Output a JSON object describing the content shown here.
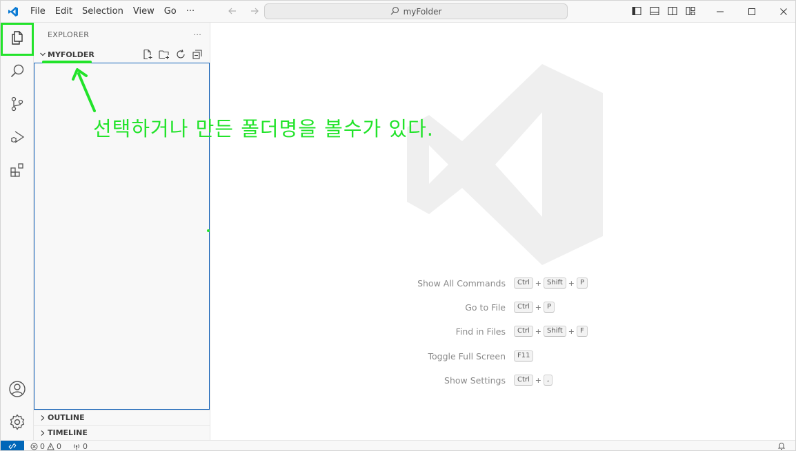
{
  "titlebar": {
    "menu": [
      "File",
      "Edit",
      "Selection",
      "View",
      "Go",
      "···"
    ],
    "search_text": "myFolder"
  },
  "sidebar": {
    "title": "EXPLORER",
    "more": "···",
    "folder_name": "MYFOLDER",
    "outline": "OUTLINE",
    "timeline": "TIMELINE"
  },
  "editor": {
    "shortcuts": [
      {
        "label": "Show All Commands",
        "keys": [
          "Ctrl",
          "Shift",
          "P"
        ]
      },
      {
        "label": "Go to File",
        "keys": [
          "Ctrl",
          "P"
        ]
      },
      {
        "label": "Find in Files",
        "keys": [
          "Ctrl",
          "Shift",
          "F"
        ]
      },
      {
        "label": "Toggle Full Screen",
        "keys": [
          "F11"
        ]
      },
      {
        "label": "Show Settings",
        "keys": [
          "Ctrl",
          ","
        ]
      }
    ]
  },
  "statusbar": {
    "errors": "0",
    "warnings": "0",
    "ports": "0"
  },
  "annotation": {
    "text": "선택하거나 만든 폴더명을 볼수가 있다.",
    "color": "#22e32a"
  },
  "colors": {
    "accent": "#0066b8",
    "focus_border": "#0f5fb8"
  }
}
